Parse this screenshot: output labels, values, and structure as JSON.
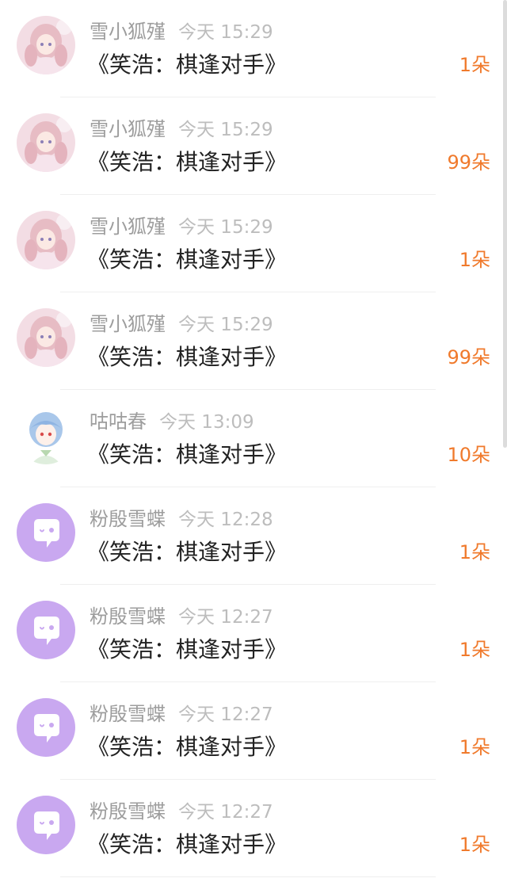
{
  "messages": [
    {
      "name": "雪小狐殣",
      "time": "今天 15:29",
      "content": "《笑浩：棋逢对手》",
      "amount": "1朵",
      "avatar": "anime-girl-avatar"
    },
    {
      "name": "雪小狐殣",
      "time": "今天 15:29",
      "content": "《笑浩：棋逢对手》",
      "amount": "99朵",
      "avatar": "anime-girl-avatar"
    },
    {
      "name": "雪小狐殣",
      "time": "今天 15:29",
      "content": "《笑浩：棋逢对手》",
      "amount": "1朵",
      "avatar": "anime-girl-avatar"
    },
    {
      "name": "雪小狐殣",
      "time": "今天 15:29",
      "content": "《笑浩：棋逢对手》",
      "amount": "99朵",
      "avatar": "anime-girl-avatar"
    },
    {
      "name": "咕咕春",
      "time": "今天 13:09",
      "content": "《笑浩：棋逢对手》",
      "amount": "10朵",
      "avatar": "blue-hair-boy-avatar"
    },
    {
      "name": "粉殷雪蝶",
      "time": "今天 12:28",
      "content": "《笑浩：棋逢对手》",
      "amount": "1朵",
      "avatar": "default-chat-bubble-avatar"
    },
    {
      "name": "粉殷雪蝶",
      "time": "今天 12:27",
      "content": "《笑浩：棋逢对手》",
      "amount": "1朵",
      "avatar": "default-chat-bubble-avatar"
    },
    {
      "name": "粉殷雪蝶",
      "time": "今天 12:27",
      "content": "《笑浩：棋逢对手》",
      "amount": "1朵",
      "avatar": "default-chat-bubble-avatar"
    },
    {
      "name": "粉殷雪蝶",
      "time": "今天 12:27",
      "content": "《笑浩：棋逢对手》",
      "amount": "1朵",
      "avatar": "default-chat-bubble-avatar"
    }
  ],
  "colors": {
    "amount": "#f07a2c",
    "name": "#9d9d9d",
    "time": "#bdbdbd",
    "content": "#222222",
    "default_avatar_bg": "#c9a8f0"
  }
}
